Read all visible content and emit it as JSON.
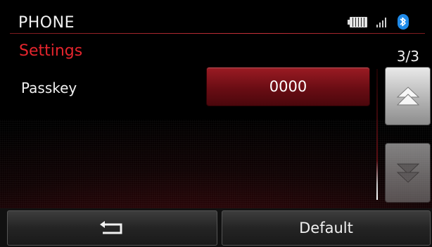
{
  "header": {
    "title": "PHONE",
    "icons": [
      "battery-icon",
      "signal-icon",
      "bluetooth-icon"
    ]
  },
  "section": {
    "title": "Settings",
    "page_indicator": "3/3"
  },
  "rows": [
    {
      "label": "Passkey",
      "value": "0000"
    }
  ],
  "scroll": {
    "up_icon": "double-chevron-up-icon",
    "down_icon": "double-chevron-down-icon"
  },
  "footer": {
    "back_icon": "back-arrow-icon",
    "default_label": "Default"
  },
  "colors": {
    "accent_red": "#e5252d",
    "button_red": "#8a1720",
    "bluetooth_blue": "#1f8ae8"
  }
}
